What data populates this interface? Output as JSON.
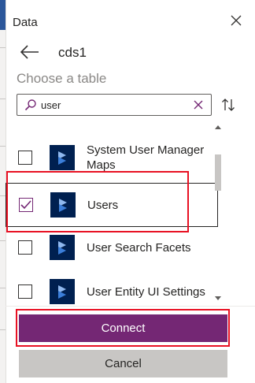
{
  "panel": {
    "title": "Data",
    "data_source": "cds1"
  },
  "picker": {
    "label": "Choose a table",
    "search_value": "user",
    "search_placeholder": "Search"
  },
  "tables": [
    {
      "name": "System User Manager Maps",
      "checked": false
    },
    {
      "name": "Users",
      "checked": true
    },
    {
      "name": "User Search Facets",
      "checked": false
    },
    {
      "name": "User Entity UI Settings",
      "checked": false
    }
  ],
  "actions": {
    "connect_label": "Connect",
    "cancel_label": "Cancel"
  },
  "colors": {
    "accent": "#742774",
    "entity_icon_bg": "#002050",
    "highlight": "#e81123"
  },
  "icons": {
    "close": "close-icon",
    "back": "back-arrow-icon",
    "search": "search-icon",
    "clear": "clear-icon",
    "sort": "sort-icon",
    "table": "dataverse-table-icon",
    "checkmark": "checkmark-icon"
  }
}
